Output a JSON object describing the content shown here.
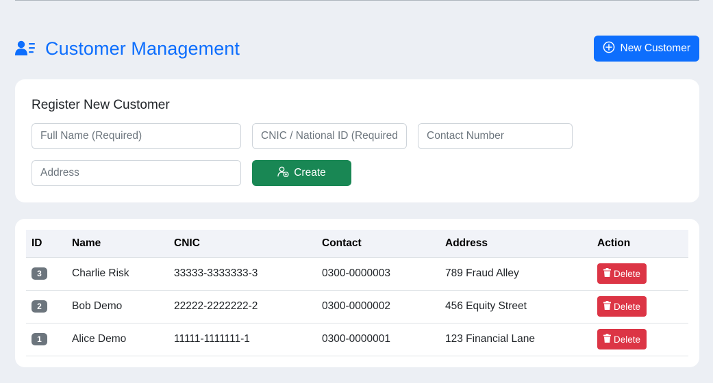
{
  "header": {
    "title": "Customer Management",
    "new_button_label": "New Customer"
  },
  "form": {
    "title": "Register New Customer",
    "full_name_placeholder": "Full Name (Required)",
    "cnic_placeholder": "CNIC / National ID (Required)",
    "contact_placeholder": "Contact Number",
    "address_placeholder": "Address",
    "create_label": "Create"
  },
  "table": {
    "headers": [
      "ID",
      "Name",
      "CNIC",
      "Contact",
      "Address",
      "Action"
    ],
    "rows": [
      {
        "id": "3",
        "name": "Charlie Risk",
        "cnic": "33333-3333333-3",
        "contact": "0300-0000003",
        "address": "789 Fraud Alley",
        "action": "Delete"
      },
      {
        "id": "2",
        "name": "Bob Demo",
        "cnic": "22222-2222222-2",
        "contact": "0300-0000002",
        "address": "456 Equity Street",
        "action": "Delete"
      },
      {
        "id": "1",
        "name": "Alice Demo",
        "cnic": "11111-1111111-1",
        "contact": "0300-0000001",
        "address": "123 Financial Lane",
        "action": "Delete"
      }
    ]
  },
  "colors": {
    "primary": "#0d6efd",
    "success": "#198754",
    "danger": "#dc3545",
    "badge": "#6c757d",
    "background": "#eceff4"
  },
  "icons": {
    "title": "users-list-icon",
    "new_button": "plus-circle-icon",
    "create_button": "user-add-icon",
    "delete_button": "trash-icon"
  }
}
